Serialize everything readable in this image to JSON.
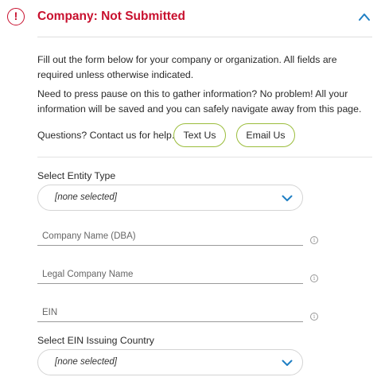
{
  "header": {
    "alert_icon_glyph": "!",
    "title": "Company: Not Submitted",
    "status_color": "#c8102e",
    "toggle_icon": "chevron-up-icon"
  },
  "intro": {
    "paragraph1": "Fill out the form below for your company or organization. All fields are required unless otherwise indicated.",
    "paragraph2": "Need to press pause on this to gather information? No problem! All your information will be saved and you can safely navigate away from this page."
  },
  "help": {
    "label": "Questions? Contact us for help.",
    "text_button": "Text Us",
    "email_button": "Email Us",
    "accent_color": "#9bbd3c"
  },
  "form": {
    "entity_type": {
      "label": "Select Entity Type",
      "value": "[none selected]"
    },
    "company_name_dba": {
      "placeholder": "Company Name (DBA)"
    },
    "legal_company_name": {
      "placeholder": "Legal Company Name"
    },
    "ein": {
      "placeholder": "EIN"
    },
    "ein_country": {
      "label": "Select EIN Issuing Country",
      "value": "[none selected]"
    },
    "info_glyph": "i",
    "chevron_color": "#1f7fc4"
  }
}
